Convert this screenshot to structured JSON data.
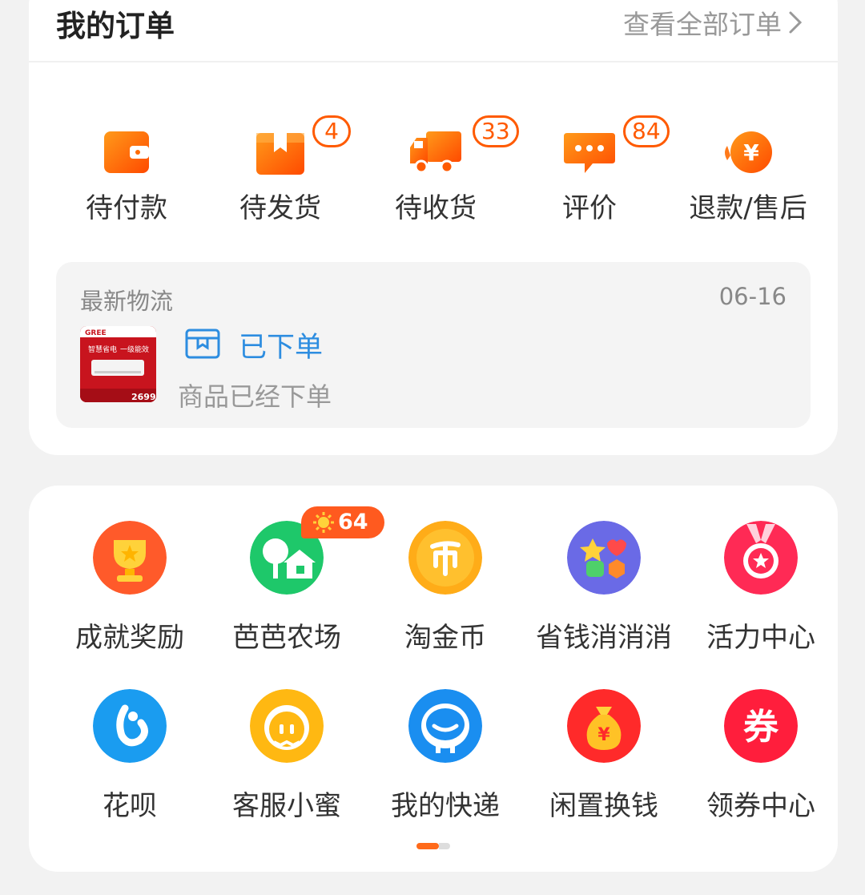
{
  "orders": {
    "title": "我的订单",
    "view_all": "查看全部订单",
    "statuses": [
      {
        "label": "待付款",
        "icon": "wallet-icon",
        "badge": ""
      },
      {
        "label": "待发货",
        "icon": "package-icon",
        "badge": "4"
      },
      {
        "label": "待收货",
        "icon": "truck-icon",
        "badge": "33"
      },
      {
        "label": "评价",
        "icon": "comment-icon",
        "badge": "84"
      },
      {
        "label": "退款/售后",
        "icon": "refund-icon",
        "badge": ""
      }
    ],
    "accent_color": "#ff5a00"
  },
  "logistics": {
    "title": "最新物流",
    "date": "06-16",
    "status": "已下单",
    "description": "商品已经下单",
    "status_color": "#2d8de0",
    "thumb": {
      "brand": "GREE",
      "slogan": "智慧省电",
      "tag": "一级能效",
      "price": "2699"
    }
  },
  "tools": [
    {
      "label": "成就奖励",
      "icon": "trophy-icon"
    },
    {
      "label": "芭芭农场",
      "icon": "farm-icon",
      "badge": "64"
    },
    {
      "label": "淘金币",
      "icon": "coin-icon"
    },
    {
      "label": "省钱消消消",
      "icon": "puzzle-game-icon"
    },
    {
      "label": "活力中心",
      "icon": "medal-icon"
    },
    {
      "label": "花呗",
      "icon": "huabei-icon"
    },
    {
      "label": "客服小蜜",
      "icon": "customer-service-icon"
    },
    {
      "label": "我的快递",
      "icon": "express-icon"
    },
    {
      "label": "闲置换钱",
      "icon": "money-bag-icon"
    },
    {
      "label": "领券中心",
      "icon": "coupon-icon"
    }
  ]
}
